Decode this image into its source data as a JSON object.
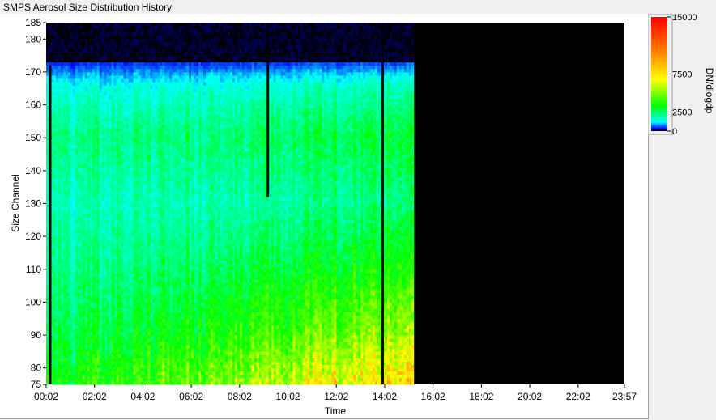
{
  "window": {
    "title": "SMPS Aerosol Size Distribution History"
  },
  "colors": {
    "plot_background": "#000000",
    "frame_background": "#f0f0f0",
    "scale_low": "#0000ff",
    "scale_mid": "#00ff00",
    "scale_high": "#ff0000"
  },
  "chart_data": {
    "type": "heatmap",
    "title": "",
    "xlabel": "Time",
    "ylabel": "Size Channel",
    "x_ticks": [
      "00:02",
      "02:02",
      "04:02",
      "06:02",
      "08:02",
      "10:02",
      "12:02",
      "14:02",
      "16:02",
      "18:02",
      "20:02",
      "22:02",
      "23:57"
    ],
    "y_ticks": [
      75,
      80,
      90,
      100,
      110,
      120,
      130,
      140,
      150,
      160,
      170,
      180,
      185
    ],
    "xlim": [
      "00:02",
      "23:57"
    ],
    "ylim": [
      75,
      185
    ],
    "data_extent": {
      "x_start": "00:02",
      "x_end": "15:10"
    },
    "colorbar": {
      "label": "DN/dlogdp",
      "ticks": [
        0,
        2500,
        7500,
        15000
      ],
      "range": [
        0,
        15000
      ],
      "stops": [
        "#000000",
        "#0000ff",
        "#00ffff",
        "#00ff00",
        "#ffff00",
        "#ff7f00",
        "#ff0000"
      ]
    },
    "gaps": [
      {
        "time": "00:12",
        "from_channel": 75,
        "to_channel": 172
      },
      {
        "time": "09:12",
        "from_channel": 132,
        "to_channel": 185
      },
      {
        "time": "13:57",
        "from_channel": 75,
        "to_channel": 185
      }
    ],
    "profile": [
      {
        "channel": 75,
        "value": 2800
      },
      {
        "channel": 90,
        "value": 2200
      },
      {
        "channel": 110,
        "value": 1800
      },
      {
        "channel": 130,
        "value": 1500
      },
      {
        "channel": 150,
        "value": 1900
      },
      {
        "channel": 165,
        "value": 1200
      },
      {
        "channel": 172,
        "value": 400
      },
      {
        "channel": 180,
        "value": 60
      }
    ]
  }
}
